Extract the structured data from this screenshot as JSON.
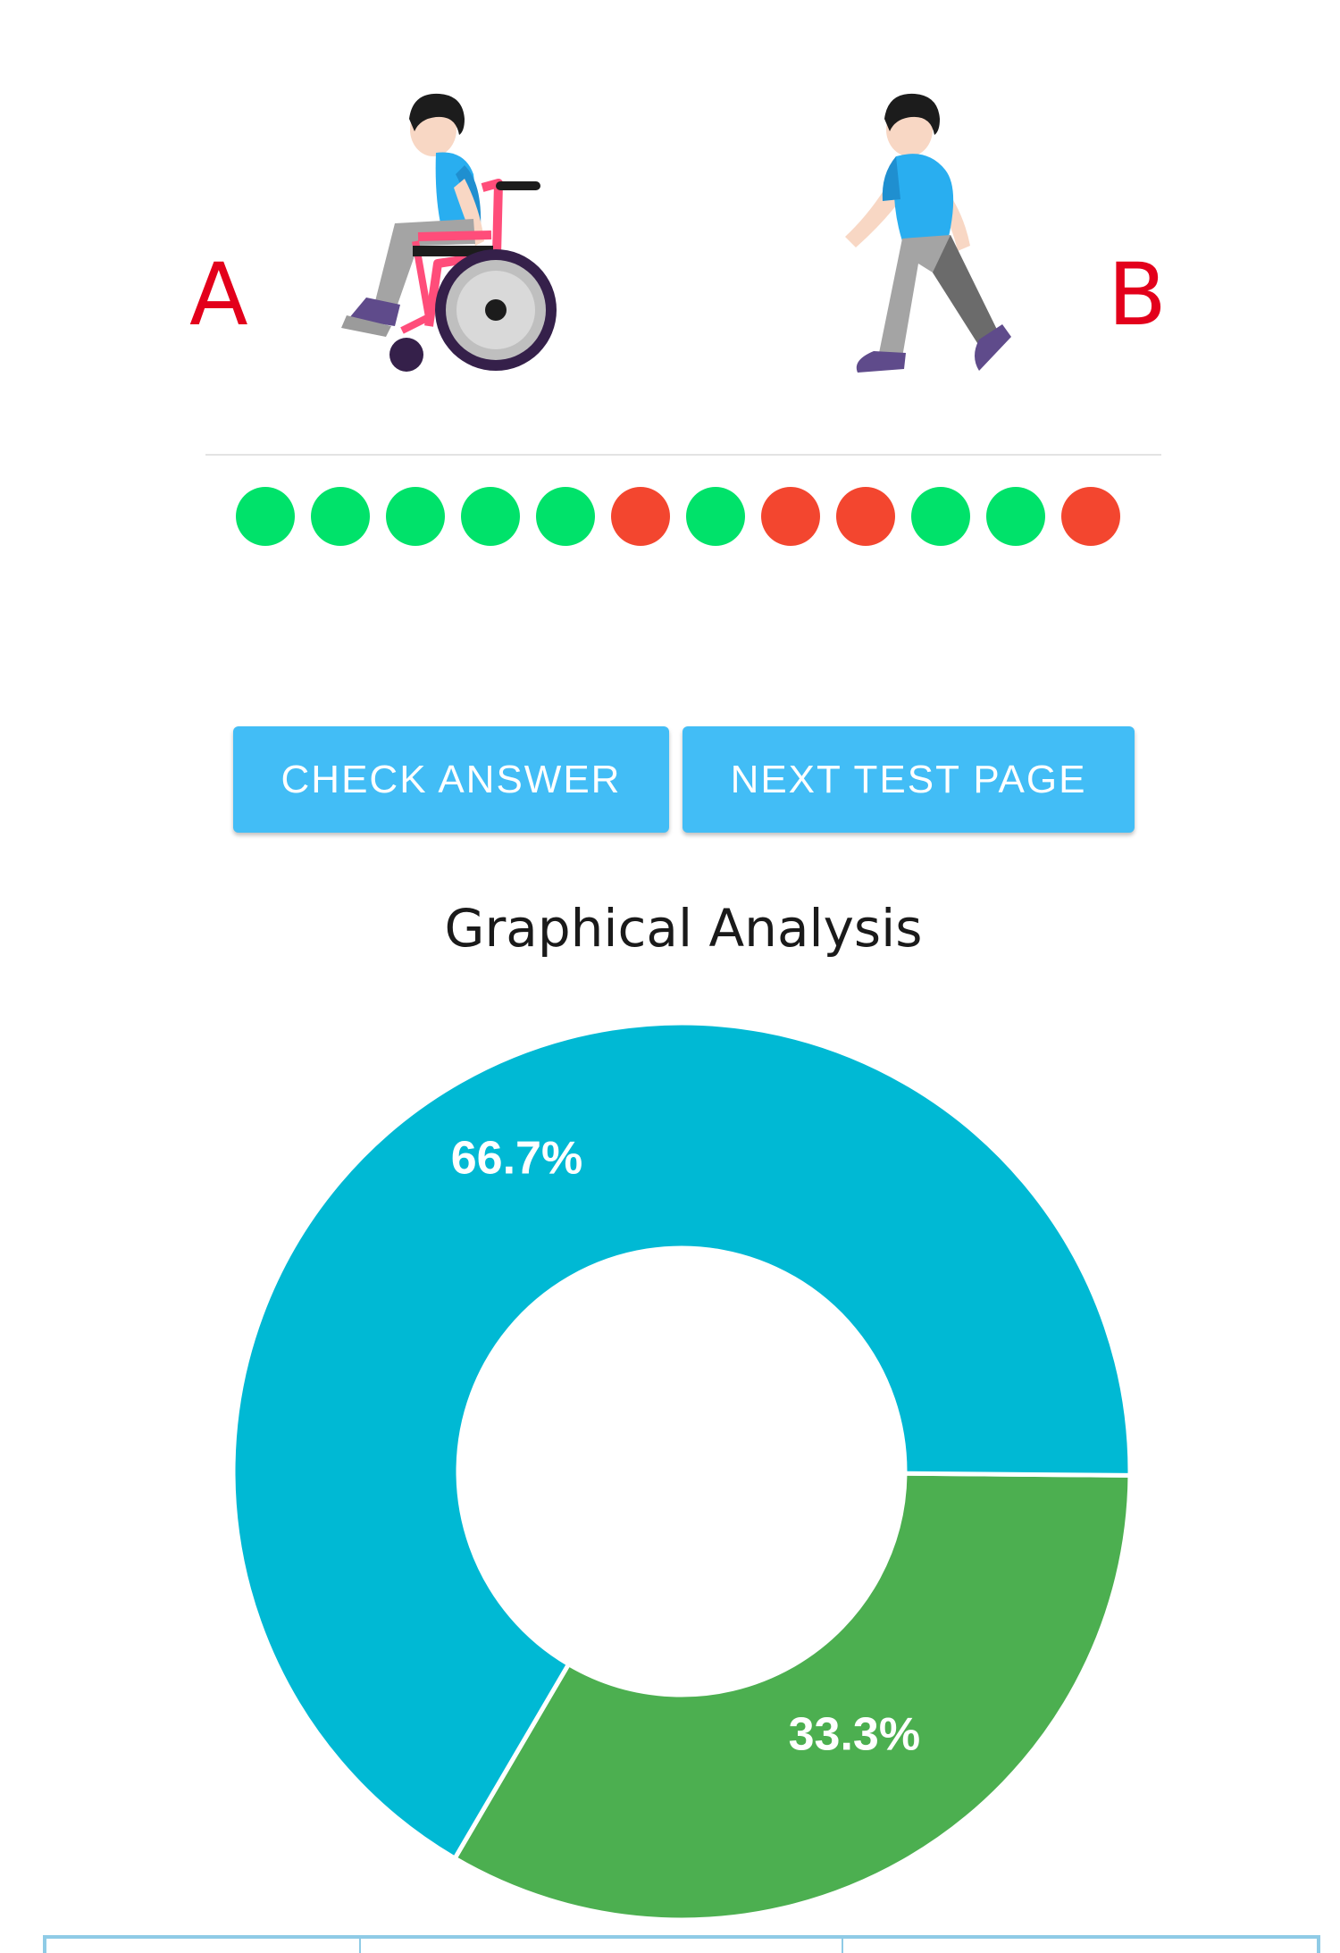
{
  "labels": {
    "left": "A",
    "right": "B"
  },
  "figures": {
    "left": "person-in-wheelchair-icon",
    "right": "person-walking-icon"
  },
  "answer_dots": [
    "correct",
    "correct",
    "correct",
    "correct",
    "correct",
    "wrong",
    "correct",
    "wrong",
    "wrong",
    "correct",
    "correct",
    "wrong"
  ],
  "colors": {
    "correct": "#00e26a",
    "wrong": "#f3462f",
    "label": "#e3001b",
    "button": "#42bdf6"
  },
  "buttons": {
    "check": "CHECK ANSWER",
    "next": "NEXT TEST PAGE"
  },
  "chart_title": "Graphical Analysis",
  "chart_data": {
    "type": "pie",
    "style": "donut",
    "slices": [
      {
        "value": 66.7,
        "label": "66.7%",
        "color": "#00b9d4"
      },
      {
        "value": 33.3,
        "label": "33.3%",
        "color": "#4caf50"
      }
    ]
  }
}
